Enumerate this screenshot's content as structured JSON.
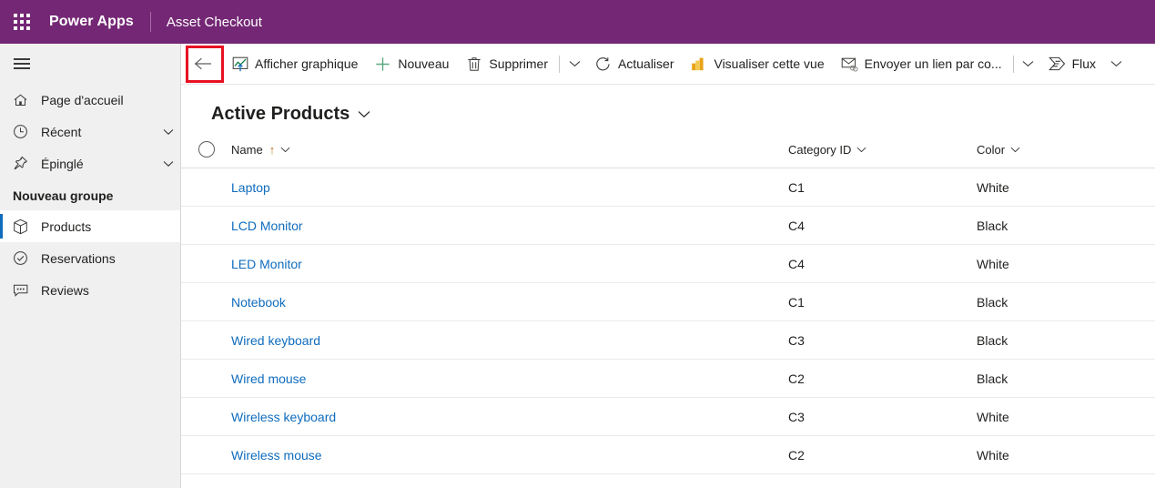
{
  "header": {
    "waffle_icon": "waffle-grid-icon",
    "brand": "Power Apps",
    "app_name": "Asset Checkout",
    "bg_color": "#742774"
  },
  "sidebar": {
    "hamburger_icon": "hamburger-menu-icon",
    "items": [
      {
        "label": "Page d'accueil",
        "icon": "home-icon",
        "has_chevron": false,
        "selected": false
      },
      {
        "label": "Récent",
        "icon": "clock-icon",
        "has_chevron": true,
        "selected": false
      },
      {
        "label": "Épinglé",
        "icon": "pin-icon",
        "has_chevron": true,
        "selected": false
      }
    ],
    "group_title": "Nouveau groupe",
    "group_items": [
      {
        "label": "Products",
        "icon": "box-icon",
        "selected": true
      },
      {
        "label": "Reservations",
        "icon": "check-circle-icon",
        "selected": false
      },
      {
        "label": "Reviews",
        "icon": "comment-icon",
        "selected": false
      }
    ],
    "selected_accent": "#0f6cbd",
    "bg_color": "#f0f0f0"
  },
  "commandbar": {
    "back": {
      "label": "Retour",
      "icon": "back-arrow-icon",
      "highlighted": true,
      "highlight_color": "#e81123"
    },
    "commands": [
      {
        "label": "Afficher graphique",
        "icon": "show-chart-icon"
      },
      {
        "label": "Nouveau",
        "icon": "plus-icon"
      },
      {
        "label": "Supprimer",
        "icon": "trash-icon"
      }
    ],
    "overflow_caret_1": "chevron-down-icon",
    "commands2": [
      {
        "label": "Actualiser",
        "icon": "refresh-icon"
      },
      {
        "label": "Visualiser cette vue",
        "icon": "powerbi-icon"
      },
      {
        "label": "Envoyer un lien par co...",
        "icon": "email-link-icon"
      }
    ],
    "overflow_caret_2": "chevron-down-icon",
    "flow": {
      "label": "Flux",
      "icon": "power-automate-icon",
      "caret": "chevron-down-icon"
    }
  },
  "view": {
    "title": "Active Products",
    "title_caret": "chevron-down-icon"
  },
  "grid": {
    "select_all": "select-all-circle",
    "columns": [
      {
        "key": "name",
        "label": "Name",
        "sorted": true,
        "sort_dir": "asc",
        "sort_glyph": "↑",
        "caret": "chevron-down-icon"
      },
      {
        "key": "category",
        "label": "Category ID",
        "sorted": false,
        "caret": "chevron-down-icon"
      },
      {
        "key": "color",
        "label": "Color",
        "sorted": false,
        "caret": "chevron-down-icon"
      }
    ],
    "rows": [
      {
        "name": "Laptop",
        "category": "C1",
        "color": "White"
      },
      {
        "name": "LCD Monitor",
        "category": "C4",
        "color": "Black"
      },
      {
        "name": "LED Monitor",
        "category": "C4",
        "color": "White"
      },
      {
        "name": "Notebook",
        "category": "C1",
        "color": "Black"
      },
      {
        "name": "Wired keyboard",
        "category": "C3",
        "color": "Black"
      },
      {
        "name": "Wired mouse",
        "category": "C2",
        "color": "Black"
      },
      {
        "name": "Wireless keyboard",
        "category": "C3",
        "color": "White"
      },
      {
        "name": "Wireless mouse",
        "category": "C2",
        "color": "White"
      }
    ],
    "link_color": "#0f6cbd"
  }
}
